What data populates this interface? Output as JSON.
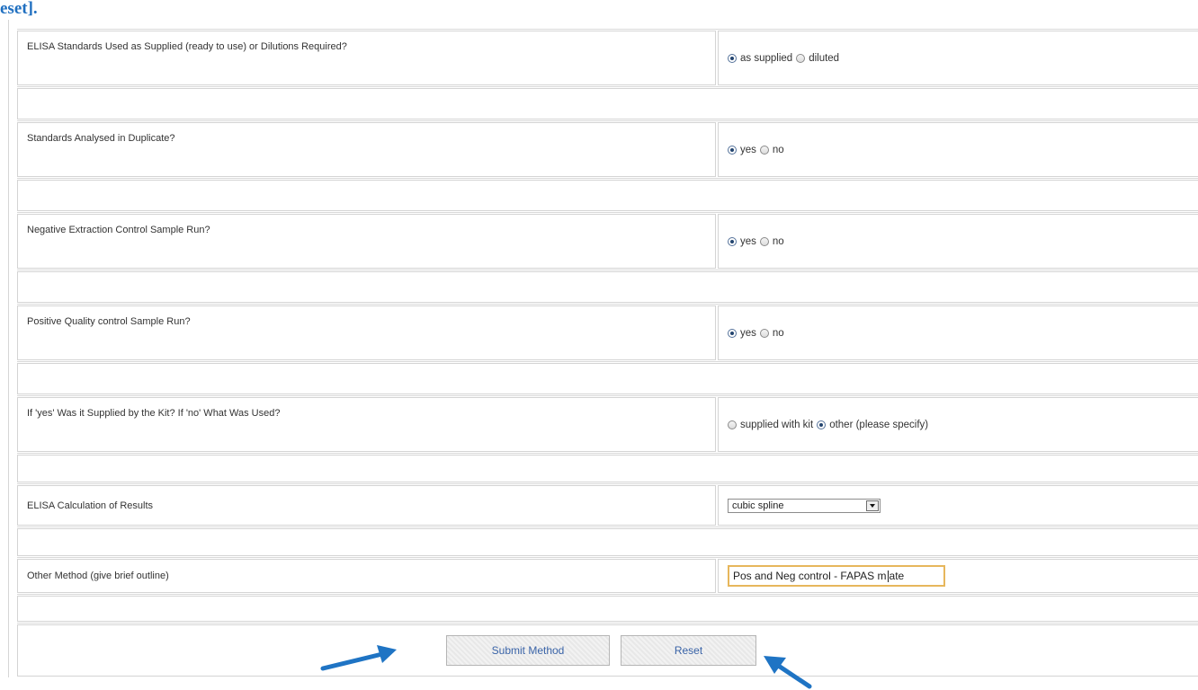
{
  "page": {
    "heading_fragment": "eset]."
  },
  "form": {
    "rows": [
      {
        "question": "ELISA Standards Used as Supplied (ready to use) or Dilutions Required?",
        "options": [
          {
            "label": "as supplied",
            "selected": true
          },
          {
            "label": "diluted",
            "selected": false
          }
        ]
      },
      {
        "question": "Standards Analysed in Duplicate?",
        "options": [
          {
            "label": "yes",
            "selected": true
          },
          {
            "label": "no",
            "selected": false
          }
        ]
      },
      {
        "question": "Negative Extraction Control Sample Run?",
        "options": [
          {
            "label": "yes",
            "selected": true
          },
          {
            "label": "no",
            "selected": false
          }
        ]
      },
      {
        "question": "Positive Quality control Sample Run?",
        "options": [
          {
            "label": "yes",
            "selected": true
          },
          {
            "label": "no",
            "selected": false
          }
        ]
      },
      {
        "question": "If 'yes' Was it Supplied by the Kit? If 'no' What Was Used?",
        "options": [
          {
            "label": "supplied with kit",
            "selected": false
          },
          {
            "label": "other (please specify)",
            "selected": true
          }
        ]
      }
    ],
    "calculation": {
      "question": "ELISA Calculation of Results",
      "selected_value": "cubic spline"
    },
    "other_method": {
      "question": "Other Method (give brief outline)",
      "value_before_caret": "Pos and Neg control - FAPAS m",
      "value_after_caret": "ate"
    },
    "buttons": {
      "submit_label": "Submit Method",
      "reset_label": "Reset"
    }
  },
  "colors": {
    "heading": "#1f6fc0",
    "annotation_arrow": "#1f74c4",
    "input_focus_border": "#e7b75c",
    "button_text": "#3a64a8"
  },
  "icons": [
    "radio-button-icon",
    "dropdown-arrow-icon",
    "annotation-arrow-icon"
  ]
}
